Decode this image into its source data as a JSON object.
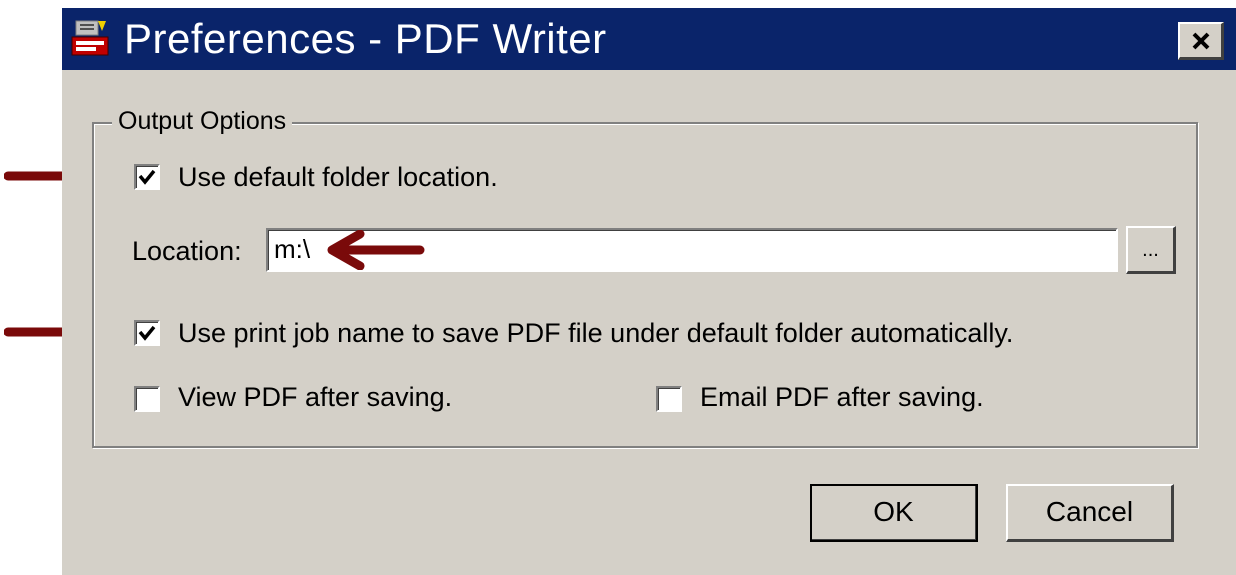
{
  "window": {
    "title": "Preferences - PDF Writer",
    "close_label": "close"
  },
  "output_options": {
    "legend": "Output Options",
    "use_default_folder": {
      "label": "Use default folder location.",
      "checked": true
    },
    "location": {
      "label": "Location:",
      "value": "m:\\",
      "browse_label": "..."
    },
    "use_print_job_name": {
      "label": "Use print job name to save PDF file under default folder automatically.",
      "checked": true
    },
    "view_pdf": {
      "label": "View PDF after saving.",
      "checked": false
    },
    "email_pdf": {
      "label": "Email PDF after saving.",
      "checked": false
    }
  },
  "buttons": {
    "ok": "OK",
    "cancel": "Cancel"
  },
  "annotations": {
    "arrow_color": "#7a0a0a"
  },
  "colors": {
    "titlebar": "#0a246a",
    "dialog": "#d4d0c8"
  },
  "icons": {
    "app": "pdf-writer-app-icon",
    "close": "close-x-icon",
    "check": "checkmark-icon",
    "arrow": "annotation-arrow-icon"
  }
}
